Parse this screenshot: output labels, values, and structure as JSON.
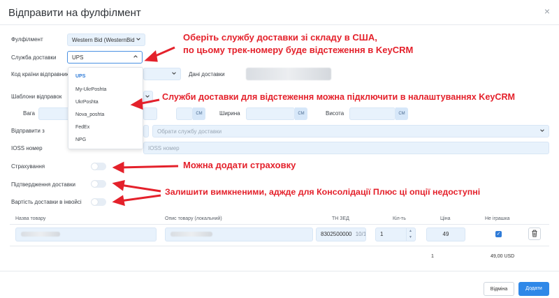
{
  "header": {
    "title": "Відправити на фулфілмент",
    "close": "×"
  },
  "form": {
    "fulfillment_label": "Фулфілмент",
    "fulfillment_value": "Western Bid (WesternBid",
    "delivery_service_label": "Служба доставки",
    "delivery_service_value": "UPS",
    "country_code_label": "Код країни відправника",
    "sender_data_label": "Дані доставки",
    "templates_label": "Шаблони відправок",
    "weight_label": "Вага",
    "width_label": "Ширина",
    "height_label": "Висота",
    "unit_cm": "CM",
    "send_from_label": "Відправити з",
    "send_from_placeholder": "Обрати службу доставки",
    "ioss_label": "IOSS номер",
    "ioss_placeholder": "IOSS номер",
    "insurance_label": "Страхування",
    "confirmation_label": "Підтвердження доставки",
    "invoice_cost_label": "Вартість доставки в інвойсі"
  },
  "dropdown": {
    "options": [
      "UPS",
      "My-UkrPoshta",
      "UkrPoshta",
      "Nova_poshta",
      "FedEx",
      "NPG"
    ]
  },
  "annotations": {
    "a1_line1": "Оберіть службу доставки зі складу в США,",
    "a1_line2": "по цьому трек-номеру буде відстеження в KeyCRM",
    "a2": "Служби доставки для відстеження можна підключити в налаштуваннях KeyCRM",
    "a3": "Можна додати страховку",
    "a4": "Залишити вимкненими, аджде для Консолідації Плюс ці опції недоступні"
  },
  "table": {
    "headers": [
      "Назва товару",
      "Опис товару (локальний)",
      "ТН ЗЕД",
      "Кіл-ть",
      "Ціна",
      "Не іграшка"
    ],
    "row": {
      "hs_code": "8302500000",
      "hs_count": "10/10",
      "qty": "1",
      "price": "49"
    },
    "totals": {
      "qty": "1",
      "sum": "49,00 USD"
    }
  },
  "footer": {
    "cancel": "Відміна",
    "add": "Додати"
  },
  "colors": {
    "annotation": "#e4212b",
    "primary": "#2f88e8"
  }
}
